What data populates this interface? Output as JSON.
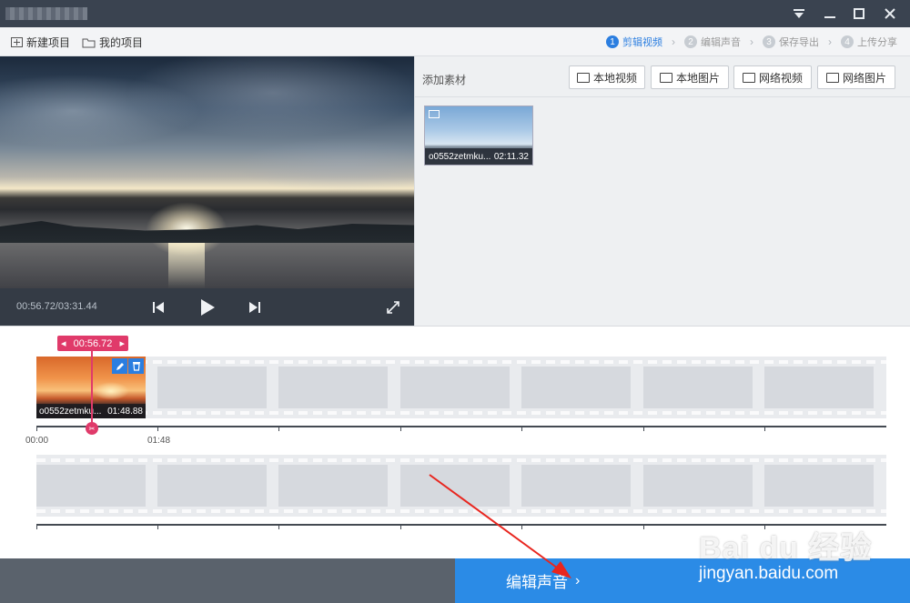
{
  "toolbar": {
    "new_project": "新建项目",
    "my_projects": "我的项目",
    "steps": [
      {
        "num": "1",
        "label": "剪辑视频"
      },
      {
        "num": "2",
        "label": "编辑声音"
      },
      {
        "num": "3",
        "label": "保存导出"
      },
      {
        "num": "4",
        "label": "上传分享"
      }
    ]
  },
  "preview": {
    "time": "00:56.72/03:31.44"
  },
  "materials": {
    "label": "添加素材",
    "buttons": [
      "本地视频",
      "本地图片",
      "网络视频",
      "网络图片"
    ],
    "items": [
      {
        "name": "o0552zetmku...",
        "duration": "02:11.32"
      }
    ]
  },
  "timeline": {
    "cursor_time": "00:56.72",
    "clip": {
      "name": "o0552zetmku...",
      "duration": "01:48.88"
    },
    "ruler_start": "00:00",
    "ruler_mark": "01:48"
  },
  "footer": {
    "next_label": "编辑声音"
  },
  "watermark": {
    "logo": "Bai du 经验",
    "url": "jingyan.baidu.com"
  },
  "colors": {
    "accent": "#2b8be6",
    "cursor": "#e03a6a",
    "titlebar": "#3a4350"
  }
}
